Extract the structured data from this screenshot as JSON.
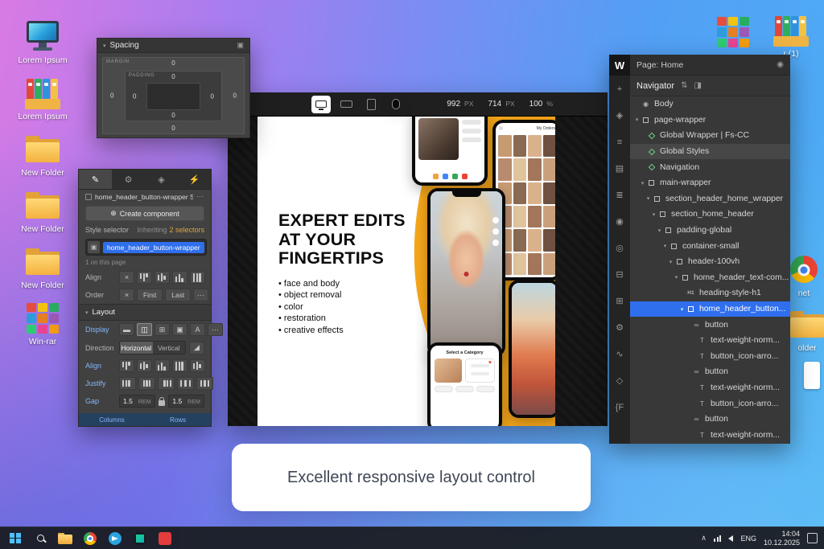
{
  "colors": {
    "selection_blue": "#2F6FED",
    "page_accent": "#F6A71B",
    "inherit_amber": "#E0A43C"
  },
  "desktop": {
    "icons": [
      {
        "art": "monitor",
        "label": "Lorem Ipsum"
      },
      {
        "art": "binders",
        "label": "Lorem Ipsum"
      },
      {
        "art": "folder",
        "label": "New Folder"
      },
      {
        "art": "folder",
        "label": "New Folder"
      },
      {
        "art": "folder",
        "label": "New Folder"
      },
      {
        "art": "winrar",
        "label": "Win-rar"
      }
    ],
    "top_right_icons": [
      {
        "art": "winrar",
        "label": ""
      },
      {
        "art": "binders",
        "label": "r (1)"
      }
    ],
    "edge_icons": [
      {
        "art": "chrome",
        "label": "net"
      },
      {
        "art": "folder",
        "label": "older"
      },
      {
        "art": "document",
        "label": ""
      }
    ]
  },
  "spacing_panel": {
    "title": "Spacing",
    "margin_label": "MARGIN",
    "padding_label": "PADDING",
    "margin": {
      "top": "0",
      "right": "0",
      "bottom": "0",
      "left": "0"
    },
    "padding": {
      "top": "0",
      "right": "0",
      "bottom": "0",
      "left": "0"
    }
  },
  "style_panel": {
    "tabs": [
      "brush",
      "gear",
      "nodes",
      "bolt"
    ],
    "header_title": "home_header_button-wrapper Styl",
    "create_component": "Create component",
    "style_selector_label": "Style selector",
    "inheriting_label": "Inheriting",
    "inheriting_count": "2 selectors",
    "selector_value": "home_header_button-wrapper",
    "usage_note": "1 on this page",
    "align_label": "Align",
    "align_options": [
      "x",
      "align-start",
      "align-center",
      "align-end",
      "align-stretch"
    ],
    "order_label": "Order",
    "order_options": [
      "First",
      "Last"
    ],
    "layout_title": "Layout",
    "display_label": "Display",
    "display_options": [
      "block",
      "flex",
      "grid",
      "inline-block",
      "inline",
      "more"
    ],
    "display_active_index": 1,
    "direction_label": "Direction",
    "direction_options": [
      "Horizontal",
      "Vertical"
    ],
    "direction_active_index": 0,
    "flex_align_label": "Align",
    "flex_align_options": [
      "align-start",
      "align-center",
      "align-end",
      "align-stretch",
      "align-baseline"
    ],
    "justify_label": "Justify",
    "justify_options": [
      "justify-start",
      "justify-center",
      "justify-end",
      "justify-between",
      "justify-around"
    ],
    "gap_label": "Gap",
    "gap_columns": {
      "value": "1.5",
      "unit": "REM"
    },
    "gap_rows": {
      "value": "1.5",
      "unit": "REM"
    },
    "columns_label": "Columns",
    "rows_label": "Rows"
  },
  "canvas": {
    "toolbar": {
      "width_value": "992",
      "width_unit": "PX",
      "height_value": "714",
      "height_unit": "PX",
      "zoom_value": "100",
      "zoom_unit": "%"
    },
    "page": {
      "heading_lines": [
        "EXPERT EDITS",
        "AT YOUR",
        "FINGERTIPS"
      ],
      "bullets": [
        "face and body",
        "object removal",
        "color",
        "restoration",
        "creative effects"
      ],
      "phone_gallery_title": "My Orders",
      "phone_category_title": "Select a Category"
    }
  },
  "navigator": {
    "page_label": "Page: Home",
    "title": "Navigator",
    "rail": [
      "add-elements",
      "components",
      "navigator",
      "pages",
      "cms",
      "users",
      "audiences",
      "ecommerce",
      "assets",
      "settings",
      "integrations",
      "apps",
      "custom-code"
    ],
    "tree": [
      {
        "icon": "eye",
        "label": "Body",
        "depth": 0
      },
      {
        "icon": "box",
        "label": "page-wrapper",
        "depth": 0,
        "chevron": true
      },
      {
        "icon": "component",
        "label": "Global Wrapper | Fs-CC",
        "depth": 1
      },
      {
        "icon": "component",
        "label": "Global Styles",
        "depth": 1,
        "hover": true
      },
      {
        "icon": "component",
        "label": "Navigation",
        "depth": 1
      },
      {
        "icon": "box",
        "label": "main-wrapper",
        "depth": 1,
        "chevron": true
      },
      {
        "icon": "box",
        "label": "section_header_home_wrapper",
        "depth": 2,
        "chevron": true
      },
      {
        "icon": "box",
        "label": "section_home_header",
        "depth": 3,
        "chevron": true
      },
      {
        "icon": "box",
        "label": "padding-global",
        "depth": 4,
        "chevron": true
      },
      {
        "icon": "box",
        "label": "container-small",
        "depth": 5,
        "chevron": true
      },
      {
        "icon": "box",
        "label": "header-100vh",
        "depth": 6,
        "chevron": true
      },
      {
        "icon": "box",
        "label": "home_header_text-com...",
        "depth": 7,
        "chevron": true
      },
      {
        "icon": "h1",
        "label": "heading-style-h1",
        "depth": 8
      },
      {
        "icon": "box",
        "label": "home_header_button...",
        "depth": 8,
        "chevron": true,
        "selected": true
      },
      {
        "icon": "link",
        "label": "button",
        "depth": 9
      },
      {
        "icon": "text",
        "label": "text-weight-norm...",
        "depth": 10
      },
      {
        "icon": "text",
        "label": "button_icon-arro...",
        "depth": 10
      },
      {
        "icon": "link",
        "label": "button",
        "depth": 9
      },
      {
        "icon": "text",
        "label": "text-weight-norm...",
        "depth": 10
      },
      {
        "icon": "text",
        "label": "button_icon-arro...",
        "depth": 10
      },
      {
        "icon": "link",
        "label": "button",
        "depth": 9
      },
      {
        "icon": "text",
        "label": "text-weight-norm...",
        "depth": 10
      }
    ]
  },
  "caption_card": {
    "text": "Excellent responsive layout control"
  },
  "taskbar": {
    "apps": [
      "start",
      "search",
      "explorer",
      "chrome",
      "telegram",
      "ide",
      "red-app"
    ],
    "tray": {
      "lang": "ENG",
      "time": "14:04",
      "date": "10.12.2025"
    }
  }
}
